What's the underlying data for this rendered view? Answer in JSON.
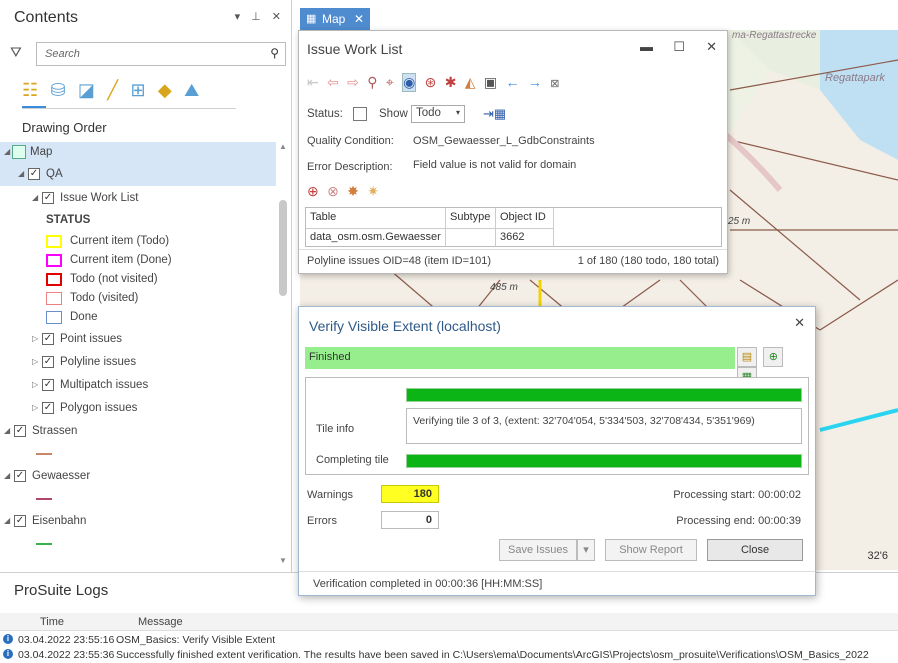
{
  "contents": {
    "title": "Contents",
    "title_icons": "▾ ⊥ ✕",
    "search_placeholder": "Search",
    "drawing_order": "Drawing Order",
    "layers": {
      "map": "Map",
      "qa": "QA",
      "issue_work_list": "Issue Work List",
      "status_heading": "STATUS",
      "legend": [
        {
          "label": "Current item (Todo)",
          "color": "#ffff00",
          "type": "box"
        },
        {
          "label": "Current item (Done)",
          "color": "#ff00ff",
          "type": "box"
        },
        {
          "label": "Todo (not visited)",
          "color": "#e00000",
          "type": "box"
        },
        {
          "label": "Todo (visited)",
          "color": "#f08080",
          "type": "box"
        },
        {
          "label": "Done",
          "color": "#6a8fd0",
          "type": "box"
        }
      ],
      "point_issues": "Point issues",
      "polyline_issues": "Polyline issues",
      "multipatch_issues": "Multipatch issues",
      "polygon_issues": "Polygon issues",
      "strassen": "Strassen",
      "gewaesser": "Gewaesser",
      "eisenbahn": "Eisenbahn"
    },
    "line_colors": {
      "strassen": "#c9876a",
      "gewaesser": "#b4466e",
      "eisenbahn": "#3ab24a"
    }
  },
  "map": {
    "tab_label": "Map",
    "labels": {
      "regatta_top": "ma-Regattastrecke",
      "regattapark": "Regattapark",
      "distance_485": "485 m",
      "distance_25": "25 m",
      "scale_partial": "32'6"
    }
  },
  "worklist": {
    "title": "Issue Work List",
    "status_label": "Status:",
    "show_label": "Show",
    "show_value": "Todo",
    "quality_condition_label": "Quality Condition:",
    "quality_condition_value": "OSM_Gewaesser_L_GdbConstraints",
    "error_description_label": "Error Description:",
    "error_description_value": "Field value is not valid for domain",
    "table": {
      "headers": [
        "Table",
        "Subtype",
        "Object ID"
      ],
      "row": [
        "data_osm.osm.Gewaesser",
        "",
        "3662"
      ]
    },
    "footer_left": "Polyline issues OID=48 (item ID=101)",
    "footer_right": "1 of 180 (180 todo, 180 total)"
  },
  "verify": {
    "title": "Verify Visible Extent (localhost)",
    "status": "Finished",
    "tile_info_label": "Tile info",
    "tile_info_text": "Verifying tile 3 of 3, (extent: 32'704'054, 5'334'503, 32'708'434, 5'351'969)",
    "completing_label": "Completing tile",
    "progress_overall": 1.0,
    "progress_tile": 1.0,
    "warnings_label": "Warnings",
    "warnings_value": "180",
    "errors_label": "Errors",
    "errors_value": "0",
    "processing_start": "Processing start: 00:00:02",
    "processing_end": "Processing end: 00:00:39",
    "save_issues": "Save Issues",
    "show_report": "Show Report",
    "close": "Close",
    "footer": "Verification completed in 00:00:36 [HH:MM:SS]"
  },
  "logs": {
    "title": "ProSuite Logs",
    "col_time": "Time",
    "col_message": "Message",
    "rows": [
      {
        "time": "03.04.2022 23:55:16",
        "message": "OSM_Basics: Verify Visible Extent"
      },
      {
        "time": "03.04.2022 23:55:36",
        "message": "Successfully finished extent verification. The results have been saved in C:\\Users\\ema\\Documents\\ArcGIS\\Projects\\osm_prosuite\\Verifications\\OSM_Basics_2022"
      }
    ]
  },
  "colors": {
    "accent": "#4f8ccf",
    "finished": "#96ef8c",
    "progress": "#0bb516",
    "warning": "#ffff22",
    "selected_row": "#d6e6f6"
  }
}
